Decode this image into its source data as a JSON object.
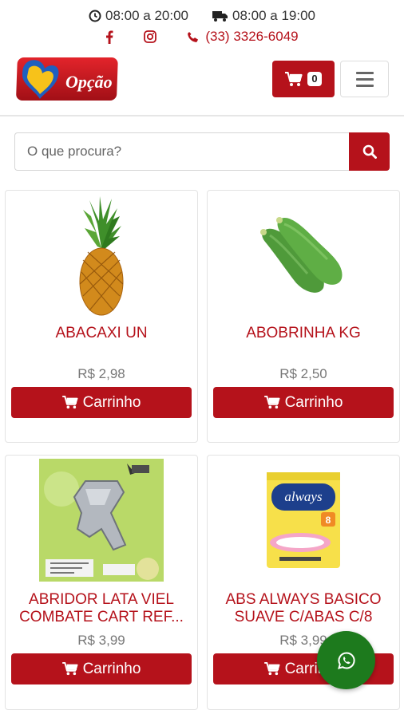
{
  "topbar": {
    "hours_store": "08:00 a 20:00",
    "hours_delivery": "08:00 a 19:00",
    "phone": "(33) 3326-6049"
  },
  "header": {
    "logo_text": "Opção",
    "cart_count": "0"
  },
  "search": {
    "placeholder": "O que procura?"
  },
  "products": [
    {
      "name": "ABACAXI UN",
      "price": "R$ 2,98",
      "button": "Carrinho",
      "image": "pineapple"
    },
    {
      "name": "ABOBRINHA KG",
      "price": "R$ 2,50",
      "button": "Carrinho",
      "image": "zucchini"
    },
    {
      "name": "ABRIDOR LATA VIEL COMBATE CART REF...",
      "price": "R$ 3,99",
      "button": "Carrinho",
      "image": "can-opener"
    },
    {
      "name": "ABS ALWAYS BASICO SUAVE C/ABAS C/8",
      "price": "R$ 3,99",
      "button": "Carrinho",
      "image": "always-pads"
    }
  ],
  "colors": {
    "accent": "#b5121b",
    "whatsapp": "#1d7a1d"
  },
  "icons": [
    "clock-icon",
    "truck-icon",
    "facebook-icon",
    "instagram-icon",
    "phone-icon",
    "cart-icon",
    "menu-icon",
    "search-icon",
    "whatsapp-icon"
  ]
}
